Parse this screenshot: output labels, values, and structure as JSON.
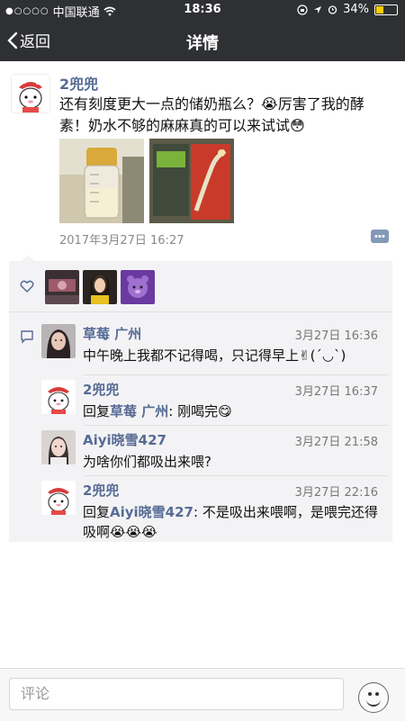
{
  "status_bar": {
    "carrier": "中国联通",
    "signal_dots": "●○○○○",
    "time": "18:36",
    "battery": "34%",
    "battery_level": 0.34
  },
  "nav": {
    "back_label": "返回",
    "title": "详情"
  },
  "post": {
    "author": "2兜兜",
    "text": "还有刻度更大一点的储奶瓶么？😭厉害了我的酵素！奶水不够的麻麻真的可以来试试😳",
    "time": "2017年3月27日 16:27"
  },
  "likes": {
    "count_avatars": 3
  },
  "comments": [
    {
      "author": "草莓 广州",
      "time": "3月27日 16:36",
      "text": "中午晚上我都不记得喝，只记得早上✌(´◡`)"
    },
    {
      "author": "2兜兜",
      "time": "3月27日 16:37",
      "reply_prefix": "回复",
      "mention": "草莓 广州",
      "text": ": 刚喝完😋"
    },
    {
      "author": "Aiyi晓雪427",
      "time": "3月27日 21:58",
      "text": "为啥你们都吸出来喂?"
    },
    {
      "author": "2兜兜",
      "time": "3月27日 22:16",
      "reply_prefix": "回复",
      "mention": "Aiyi晓雪427",
      "text": ": 不是吸出来喂啊，是喂完还得吸啊😭😭😭"
    }
  ],
  "input": {
    "placeholder": "评论"
  },
  "colors": {
    "nav_bg": "#2f3033",
    "link": "#576b95",
    "comment_bg": "#f3f3f5"
  }
}
